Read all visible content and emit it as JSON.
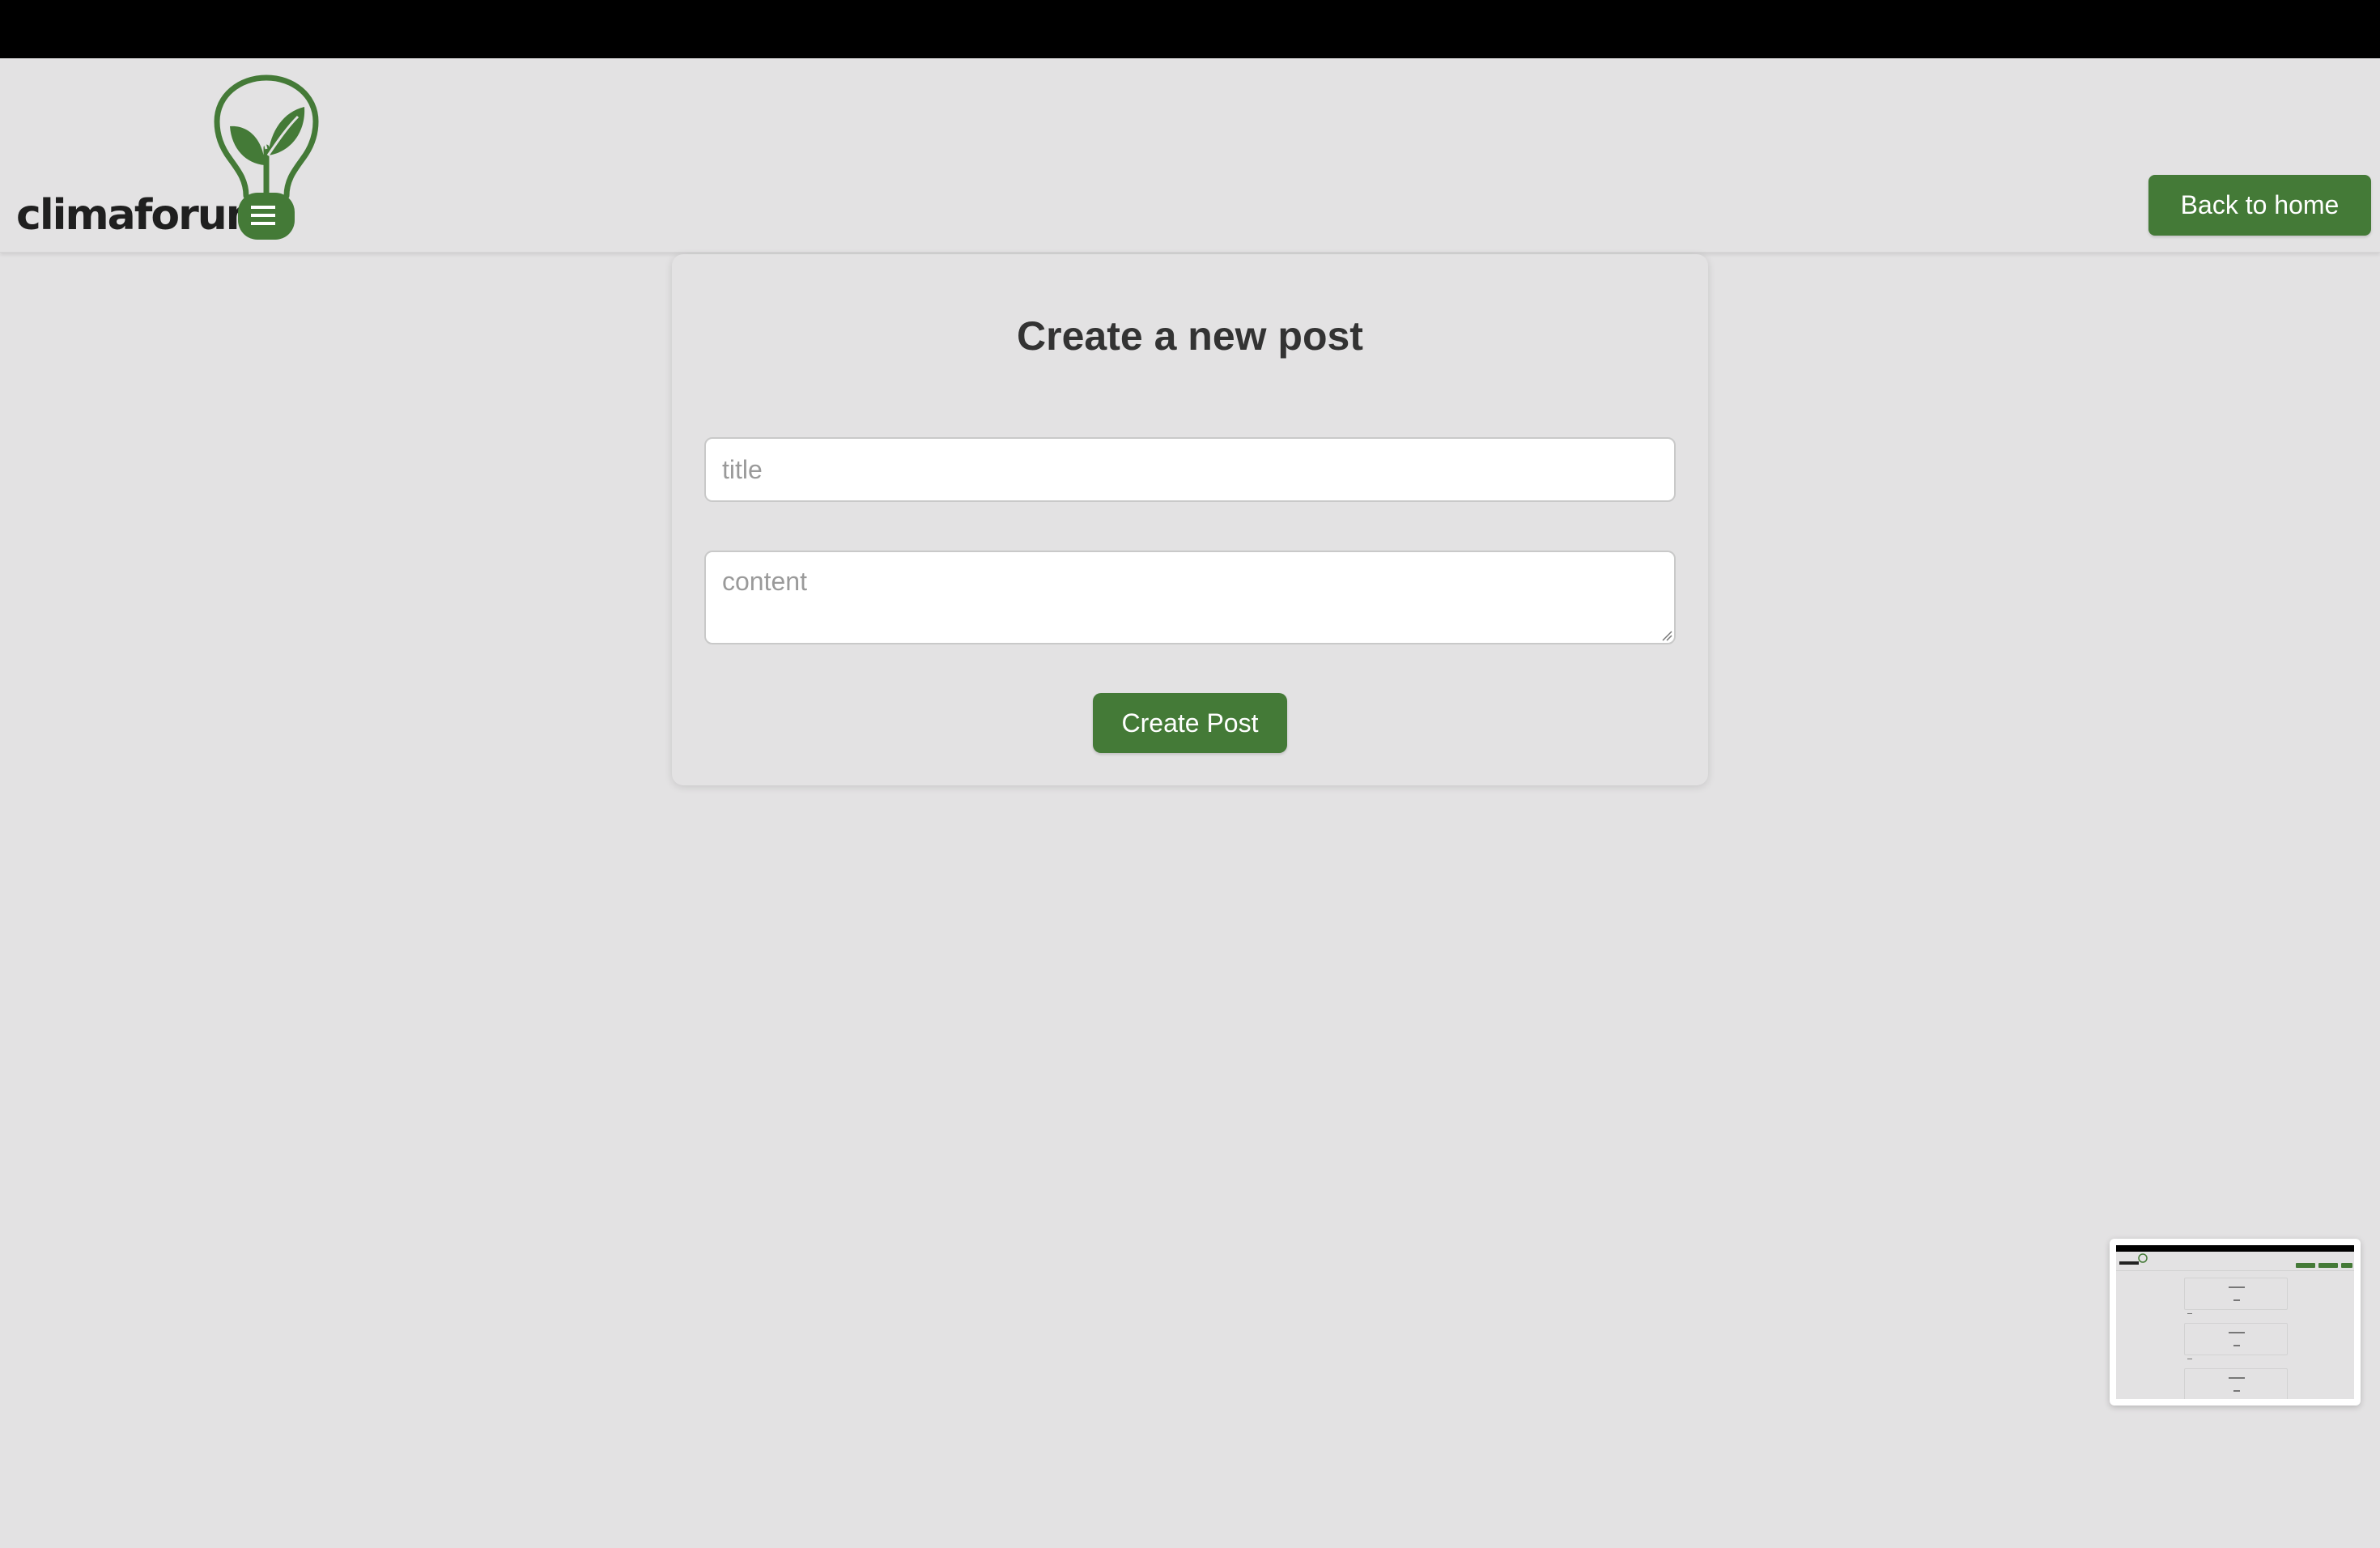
{
  "header": {
    "logo_text": "climaforum",
    "back_button_label": "Back to home"
  },
  "form": {
    "heading": "Create a new post",
    "title_field": {
      "placeholder": "title",
      "value": ""
    },
    "content_field": {
      "placeholder": "content",
      "value": ""
    },
    "submit_label": "Create Post"
  },
  "colors": {
    "brand_green": "#447a37",
    "background": "#e3e2e3",
    "topbar": "#000000"
  },
  "icons": [
    "lightbulb-leaf-logo-icon",
    "resize-grip-icon"
  ]
}
